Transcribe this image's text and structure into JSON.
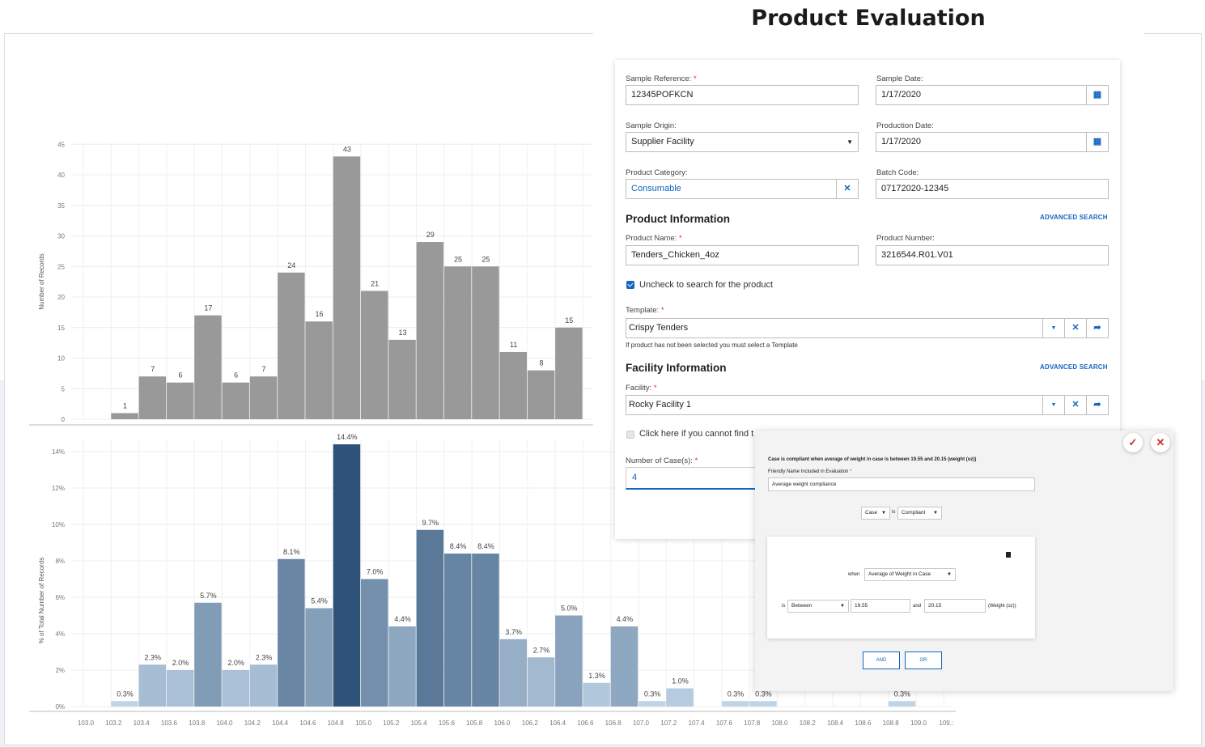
{
  "form": {
    "title": "Product Evaluation",
    "sample_reference": {
      "label": "Sample Reference:",
      "value": "12345POFKCN"
    },
    "sample_date": {
      "label": "Sample Date:",
      "value": "1/17/2020"
    },
    "sample_origin": {
      "label": "Sample Origin:",
      "value": "Supplier Facility"
    },
    "production_date": {
      "label": "Production Date:",
      "value": "1/17/2020"
    },
    "product_category": {
      "label": "Product Category:",
      "value": "Consumable"
    },
    "batch_code": {
      "label": "Batch Code:",
      "value": "07172020-12345"
    },
    "product_info_heading": "Product Information",
    "advanced_search": "ADVANCED SEARCH",
    "product_name": {
      "label": "Product Name:",
      "value": "Tenders_Chicken_4oz"
    },
    "product_number": {
      "label": "Product Number:",
      "value": "3216544.R01.V01"
    },
    "uncheck_text": "Uncheck to search for the product",
    "template": {
      "label": "Template:",
      "value": "Crispy Tenders",
      "hint": "If product has not been selected you must select a Template"
    },
    "facility_info_heading": "Facility Information",
    "facility": {
      "label": "Facility:",
      "value": "Rocky Facility 1"
    },
    "cannot_find_text": "Click here if you cannot find t",
    "cases": {
      "label": "Number of Case(s):",
      "value": "4"
    }
  },
  "rule": {
    "description": "Case is compliant when average of weight in case is between 19.55 and 20.15 (weight (oz))",
    "friendly_label": "Friendly Name Included in Evaluation",
    "friendly_value": "Average weight compliance",
    "subject": "Case",
    "is": "is",
    "status": "Compliant",
    "when": "when",
    "measure": "Average of Weight in Case",
    "is2": "is",
    "operator": "Between",
    "min": "19.55",
    "and": "and",
    "max": "20.15",
    "unit": "(Weight (oz))",
    "and_button": "AND",
    "or_button": "OR"
  },
  "icons": {
    "calendar": "calendar-icon",
    "dropdown": "chevron-down-icon",
    "clear": "close-icon",
    "link": "share-arrow-icon",
    "accept": "check-icon",
    "reject": "close-icon"
  },
  "colors": {
    "accent": "#1565c0",
    "required": "#d32f2f",
    "gray_bar": "#999999",
    "highlight_bar": "#2f5378"
  },
  "chart_data": [
    {
      "type": "bar",
      "ylabel": "Number of Records",
      "ylim": [
        0,
        45
      ],
      "yticks": [
        "0",
        "5",
        "10",
        "15",
        "20",
        "25",
        "30",
        "35",
        "40",
        "45"
      ],
      "categories": [
        "103.4",
        "103.6",
        "103.8",
        "104.0",
        "104.2",
        "104.4",
        "104.6",
        "104.8",
        "105.0",
        "105.2",
        "105.4",
        "105.6",
        "105.8",
        "106.0",
        "106.2",
        "106.4"
      ],
      "values": [
        1,
        7,
        6,
        17,
        6,
        7,
        24,
        16,
        43,
        21,
        13,
        29,
        25,
        25,
        11,
        8,
        15
      ],
      "labels": [
        "1",
        "7",
        "6",
        "17",
        "6",
        "7",
        "24",
        "16",
        "43",
        "21",
        "13",
        "29",
        "25",
        "25",
        "11",
        "8",
        "15"
      ]
    },
    {
      "type": "bar",
      "ylabel": "% of Total Number of Records",
      "ylim": [
        0,
        15
      ],
      "yticks": [
        "0%",
        "2%",
        "4%",
        "6%",
        "8%",
        "10%",
        "12%",
        "14%"
      ],
      "xticks": [
        "103.0",
        "103.2",
        "103.4",
        "103.6",
        "103.8",
        "104.0",
        "104.2",
        "104.4",
        "104.6",
        "104.8",
        "105.0",
        "105.2",
        "105.4",
        "105.6",
        "105.8",
        "106.0",
        "106.2",
        "106.4",
        "106.6",
        "106.8",
        "107.0",
        "107.2",
        "107.4",
        "107.6",
        "107.8",
        "108.0",
        "108.2",
        "108.4",
        "108.6",
        "108.8",
        "109.0",
        "109.:"
      ],
      "bars": [
        {
          "x": "103.2",
          "value": 0.3,
          "label": "0.3%"
        },
        {
          "x": "103.4",
          "value": 2.3,
          "label": "2.3%"
        },
        {
          "x": "103.6",
          "value": 2.0,
          "label": "2.0%"
        },
        {
          "x": "103.8",
          "value": 5.7,
          "label": "5.7%"
        },
        {
          "x": "104.0",
          "value": 2.0,
          "label": "2.0%"
        },
        {
          "x": "104.2",
          "value": 2.3,
          "label": "2.3%"
        },
        {
          "x": "104.4",
          "value": 8.1,
          "label": "8.1%"
        },
        {
          "x": "104.6",
          "value": 5.4,
          "label": "5.4%"
        },
        {
          "x": "104.8",
          "value": 14.4,
          "label": "14.4%"
        },
        {
          "x": "105.0",
          "value": 7.0,
          "label": "7.0%"
        },
        {
          "x": "105.2",
          "value": 4.4,
          "label": "4.4%"
        },
        {
          "x": "105.4",
          "value": 9.7,
          "label": "9.7%"
        },
        {
          "x": "105.6",
          "value": 8.4,
          "label": "8.4%"
        },
        {
          "x": "105.8",
          "value": 8.4,
          "label": "8.4%"
        },
        {
          "x": "106.0",
          "value": 3.7,
          "label": "3.7%"
        },
        {
          "x": "106.2",
          "value": 2.7,
          "label": "2.7%"
        },
        {
          "x": "106.4",
          "value": 5.0,
          "label": "5.0%"
        },
        {
          "x": "106.6",
          "value": 1.3,
          "label": "1.3%"
        },
        {
          "x": "106.8",
          "value": 4.4,
          "label": "4.4%"
        },
        {
          "x": "107.0",
          "value": 0.3,
          "label": "0.3%"
        },
        {
          "x": "107.2",
          "value": 1.0,
          "label": "1.0%"
        },
        {
          "x": "107.6",
          "value": 0.3,
          "label": "0.3%"
        },
        {
          "x": "107.8",
          "value": 0.3,
          "label": "0.3%"
        },
        {
          "x": "108.8",
          "value": 0.3,
          "label": "0.3%"
        }
      ]
    }
  ]
}
